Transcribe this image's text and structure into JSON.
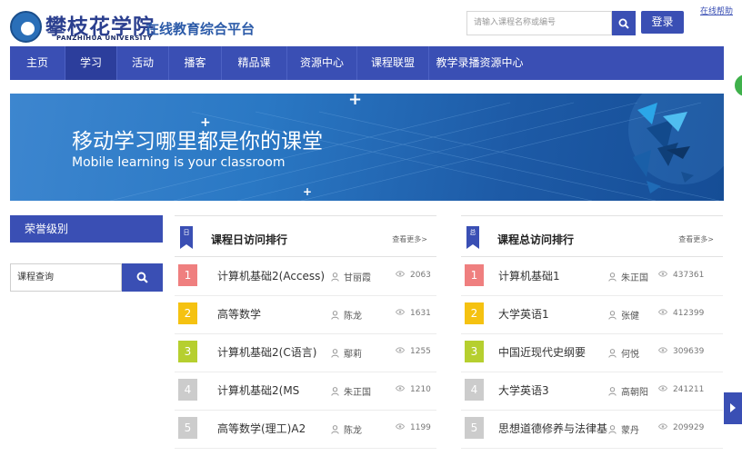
{
  "header": {
    "logo_cn": "攀枝花学院",
    "logo_en": "PANZHIHUA UNIVERSITY",
    "platform_name": "在线教育综合平台",
    "search_placeholder": "请输入课程名称或编号",
    "login_label": "登录",
    "help_label": "在线帮助"
  },
  "nav": [
    {
      "label": "主页"
    },
    {
      "label": "学习",
      "active": true
    },
    {
      "label": "活动"
    },
    {
      "label": "播客"
    },
    {
      "label": "精品课"
    },
    {
      "label": "资源中心"
    },
    {
      "label": "课程联盟"
    },
    {
      "label": "教学录播资源中心"
    }
  ],
  "banner": {
    "title": "移动学习哪里都是你的课堂",
    "subtitle": "Mobile learning is your classroom"
  },
  "sidebar": {
    "honor_label": "荣誉级别",
    "query_label": "课程查询"
  },
  "daily_ranking": {
    "badge": "日",
    "title": "课程日访问排行",
    "more": "查看更多>",
    "items": [
      {
        "rank": "1",
        "name": "计算机基础2(Access)",
        "teacher": "甘丽霞",
        "views": "2063",
        "color": "#ef7f7f"
      },
      {
        "rank": "2",
        "name": "高等数学",
        "teacher": "陈龙",
        "views": "1631",
        "color": "#f5c211"
      },
      {
        "rank": "3",
        "name": "计算机基础2(C语言)",
        "teacher": "鄢莉",
        "views": "1255",
        "color": "#b6cf2f"
      },
      {
        "rank": "4",
        "name": "计算机基础2(MS",
        "teacher": "朱正国",
        "views": "1210",
        "color": "#cccccc"
      },
      {
        "rank": "5",
        "name": "高等数学(理工)A2",
        "teacher": "陈龙",
        "views": "1199",
        "color": "#cccccc"
      }
    ]
  },
  "total_ranking": {
    "badge": "总",
    "title": "课程总访问排行",
    "more": "查看更多>",
    "items": [
      {
        "rank": "1",
        "name": "计算机基础1",
        "teacher": "朱正国",
        "views": "437361",
        "color": "#ef7f7f"
      },
      {
        "rank": "2",
        "name": "大学英语1",
        "teacher": "张健",
        "views": "412399",
        "color": "#f5c211"
      },
      {
        "rank": "3",
        "name": "中国近现代史纲要",
        "teacher": "何悦",
        "views": "309639",
        "color": "#b6cf2f"
      },
      {
        "rank": "4",
        "name": "大学英语3",
        "teacher": "高朝阳",
        "views": "241211",
        "color": "#cccccc"
      },
      {
        "rank": "5",
        "name": "思想道德修养与法律基",
        "teacher": "蒙丹",
        "views": "209929",
        "color": "#cccccc"
      }
    ]
  }
}
